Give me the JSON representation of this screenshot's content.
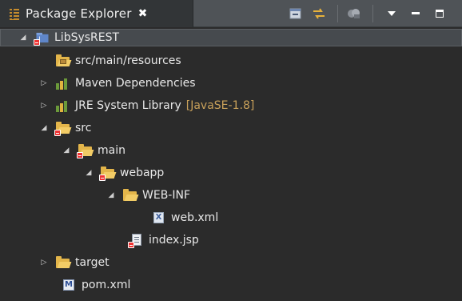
{
  "tab": {
    "title": "Package Explorer",
    "close_glyph": "✖"
  },
  "toolbar": {
    "buttons": [
      "collapse-all-icon",
      "link-with-editor-icon",
      "focus-on-active-task-icon",
      "view-menu-icon",
      "minimize-icon",
      "maximize-icon"
    ]
  },
  "tree": {
    "project": {
      "label": "LibSysREST"
    },
    "items": [
      {
        "label": "src/main/resources"
      },
      {
        "label": "Maven Dependencies"
      },
      {
        "label": "JRE System Library",
        "decoration": "[JavaSE-1.8]"
      },
      {
        "label": "src"
      },
      {
        "label": "main"
      },
      {
        "label": "webapp"
      },
      {
        "label": "WEB-INF"
      },
      {
        "label": "web.xml"
      },
      {
        "label": "index.jsp"
      },
      {
        "label": "target"
      },
      {
        "label": "pom.xml"
      }
    ]
  },
  "colors": {
    "background": "#2b2b2b",
    "tab_bar": "#4f5357",
    "selection": "#464a4e",
    "decoration": "#c9a15a",
    "folder": "#e3b54a"
  }
}
